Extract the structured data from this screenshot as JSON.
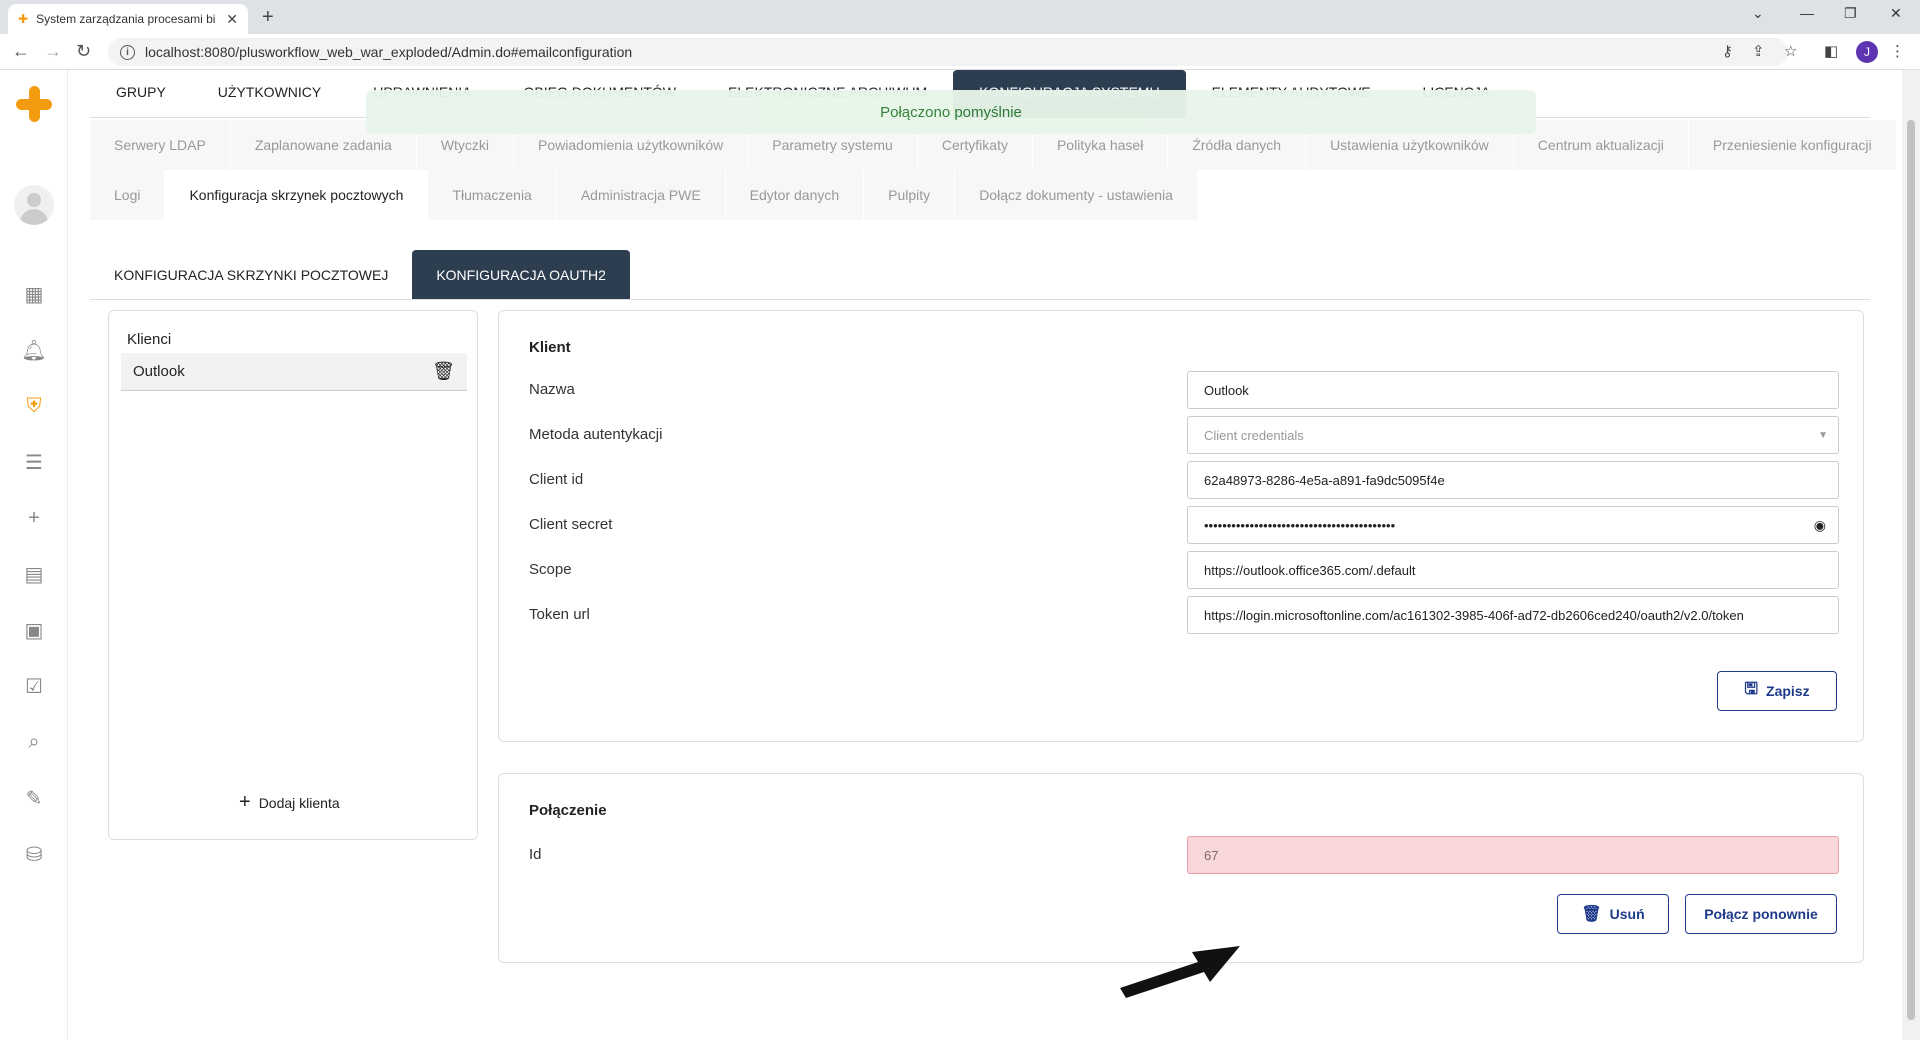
{
  "browser": {
    "tab_title": "System zarządzania procesami bi",
    "tab_close": "✕",
    "new_tab": "+",
    "url": "localhost:8080/plusworkflow_web_war_exploded/Admin.do#emailconfiguration",
    "profile_initial": "J"
  },
  "top_tabs": [
    {
      "label": "GRUPY"
    },
    {
      "label": "UŻYTKOWNICY"
    },
    {
      "label": "UPRAWNIENIA"
    },
    {
      "label": "OBIEG DOKUMENTÓW"
    },
    {
      "label": "ELEKTRONICZNE ARCHIWUM"
    },
    {
      "label": "KONFIGURACJA SYSTEMU"
    },
    {
      "label": "ELEMENTY AUDYTOWE"
    },
    {
      "label": "LICENCJA"
    }
  ],
  "toast": {
    "message": "Połączono pomyślnie"
  },
  "sub_tabs_row1": [
    {
      "label": "Serwery LDAP"
    },
    {
      "label": "Zaplanowane zadania"
    },
    {
      "label": "Wtyczki"
    },
    {
      "label": "Powiadomienia użytkowników"
    },
    {
      "label": "Parametry systemu"
    },
    {
      "label": "Certyfikaty"
    },
    {
      "label": "Polityka haseł"
    },
    {
      "label": "Źródła danych"
    },
    {
      "label": "Ustawienia użytkowników"
    },
    {
      "label": "Centrum aktualizacji"
    },
    {
      "label": "Przeniesienie konfiguracji"
    }
  ],
  "sub_tabs_row2": [
    {
      "label": "Logi"
    },
    {
      "label": "Konfiguracja skrzynek pocztowych"
    },
    {
      "label": "Tłumaczenia"
    },
    {
      "label": "Administracja PWE"
    },
    {
      "label": "Edytor danych"
    },
    {
      "label": "Pulpity"
    },
    {
      "label": "Dołącz dokumenty - ustawienia"
    }
  ],
  "inner_tabs": [
    {
      "label": "KONFIGURACJA SKRZYNKI POCZTOWEJ"
    },
    {
      "label": "KONFIGURACJA OAUTH2"
    }
  ],
  "clients": {
    "title": "Klienci",
    "items": [
      {
        "label": "Outlook"
      }
    ],
    "add_label": "Dodaj klienta"
  },
  "client_form": {
    "title": "Klient",
    "fields": [
      {
        "label": "Nazwa",
        "value": "Outlook"
      },
      {
        "label": "Metoda autentykacji",
        "value": "Client credentials"
      },
      {
        "label": "Client id",
        "value": "62a48973-8286-4e5a-a891-fa9dc5095f4e"
      },
      {
        "label": "Client secret",
        "value": "••••••••••••••••••••••••••••••••••••••••••"
      },
      {
        "label": "Scope",
        "value": "https://outlook.office365.com/.default"
      },
      {
        "label": "Token url",
        "value": "https://login.microsoftonline.com/ac161302-3985-406f-ad72-db2606ced240/oauth2/v2.0/token"
      }
    ],
    "save_label": "Zapisz"
  },
  "connection": {
    "title": "Połączenie",
    "id_label": "Id",
    "id_value": "67",
    "delete_label": "Usuń",
    "reconnect_label": "Połącz ponownie"
  },
  "colors": {
    "accent": "#f39c12",
    "dark_tab": "#2c3e50",
    "button_border": "#1e3a8a",
    "toast_bg": "#e8f5e9",
    "id_bg": "#f8d7da"
  }
}
